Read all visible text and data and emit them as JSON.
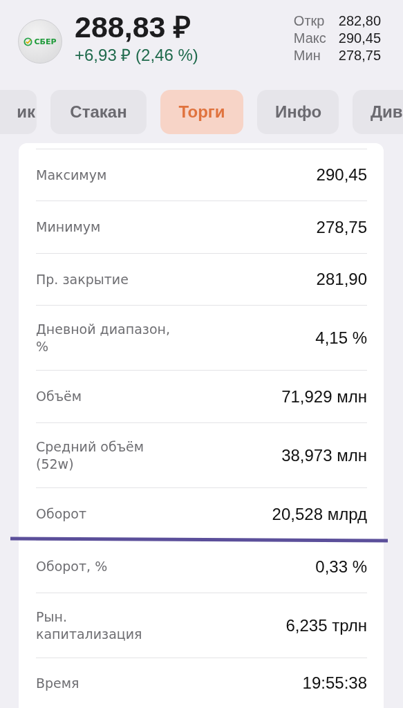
{
  "header": {
    "logo_text": "СБЕР",
    "price": "288,83 ₽",
    "change": "+6,93 ₽ (2,46 %)",
    "stats": [
      {
        "label": "Откр",
        "value": "282,80"
      },
      {
        "label": "Макс",
        "value": "290,45"
      },
      {
        "label": "Мин",
        "value": "278,75"
      }
    ]
  },
  "tabs": [
    {
      "label": "ик",
      "selected": false
    },
    {
      "label": "Стакан",
      "selected": false
    },
    {
      "label": "Торги",
      "selected": true
    },
    {
      "label": "Инфо",
      "selected": false
    },
    {
      "label": "Див",
      "selected": false
    }
  ],
  "rows": [
    {
      "label": "Максимум",
      "value": "290,45",
      "underlined": false
    },
    {
      "label": "Минимум",
      "value": "278,75",
      "underlined": false
    },
    {
      "label": "Пр. закрытие",
      "value": "281,90",
      "underlined": false
    },
    {
      "label": "Дневной диапазон, %",
      "value": "4,15 %",
      "underlined": false
    },
    {
      "label": "Объём",
      "value": "71,929 млн",
      "underlined": false
    },
    {
      "label": "Средний объём (52w)",
      "value": "38,973 млн",
      "underlined": false
    },
    {
      "label": "Оборот",
      "value": "20,528 млрд",
      "underlined": true
    },
    {
      "label": "Оборот, %",
      "value": "0,33 %",
      "underlined": false
    },
    {
      "label": "Рын. капитализация",
      "value": "6,235 трлн",
      "underlined": false
    },
    {
      "label": "Время",
      "value": "19:55:38",
      "underlined": false
    }
  ],
  "annotation": {
    "kind": "underline",
    "color": "#5b4f9a"
  }
}
